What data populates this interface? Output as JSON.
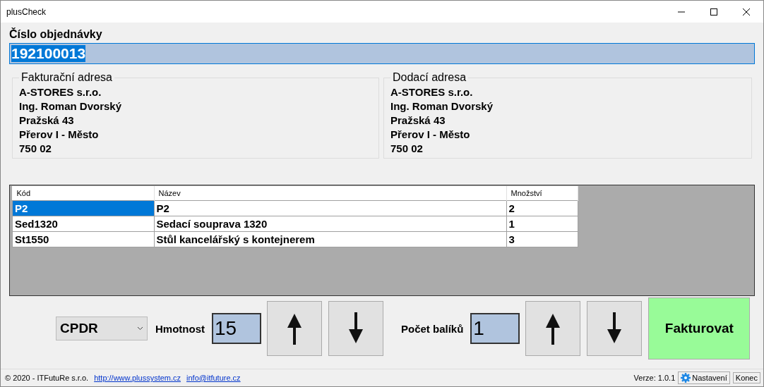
{
  "window": {
    "title": "plusCheck"
  },
  "order": {
    "label": "Číslo objednávky",
    "value": "192100013",
    "text_selected": true
  },
  "addresses": [
    {
      "title": "Fakturační adresa",
      "lines": [
        "A-STORES s.r.o.",
        "Ing. Roman Dvorský",
        "Pražská 43",
        "Přerov I - Město",
        "750 02"
      ]
    },
    {
      "title": "Dodací adresa",
      "lines": [
        "A-STORES s.r.o.",
        "Ing. Roman Dvorský",
        "Pražská 43",
        "Přerov I - Město",
        "750 02"
      ]
    }
  ],
  "table": {
    "columns": [
      "Kód",
      "Název",
      "Množství"
    ],
    "rows": [
      {
        "cells": [
          "P2",
          "P2",
          "2"
        ],
        "selected": true
      },
      {
        "cells": [
          "Sed1320",
          "Sedací souprava 1320",
          "1"
        ],
        "selected": false
      },
      {
        "cells": [
          "St1550",
          "Stůl kancelářský s kontejnerem",
          "3"
        ],
        "selected": false
      }
    ]
  },
  "controls": {
    "carrier": "CPDR",
    "weight_label": "Hmotnost",
    "weight": "15",
    "packages_label": "Počet balíků",
    "packages": "1",
    "invoice_button": "Fakturovat"
  },
  "status_bar": {
    "copyright": "© 2020 - ITFutuRe s.r.o.",
    "links": [
      "http://www.plussystem.cz",
      "info@itfuture.cz"
    ],
    "version": "Verze: 1.0.1",
    "settings": "Nastavení",
    "exit": "Konec"
  }
}
